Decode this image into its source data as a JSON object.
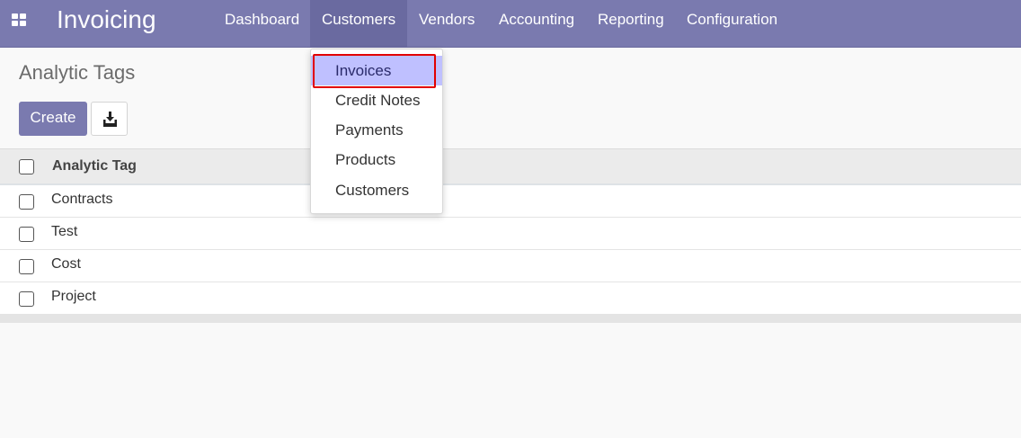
{
  "app": {
    "title": "Invoicing"
  },
  "nav": {
    "items": [
      {
        "label": "Dashboard"
      },
      {
        "label": "Customers"
      },
      {
        "label": "Vendors"
      },
      {
        "label": "Accounting"
      },
      {
        "label": "Reporting"
      },
      {
        "label": "Configuration"
      }
    ]
  },
  "page": {
    "title": "Analytic Tags",
    "create_label": "Create"
  },
  "table": {
    "header": "Analytic Tag",
    "rows": [
      "Contracts",
      "Test",
      "Cost",
      "Project"
    ]
  },
  "dropdown": {
    "items": [
      "Invoices",
      "Credit Notes",
      "Payments",
      "Products",
      "Customers"
    ]
  },
  "colors": {
    "brand": "#7a7aaf",
    "highlight": "#bfc0ff",
    "annotation": "#e20000"
  }
}
